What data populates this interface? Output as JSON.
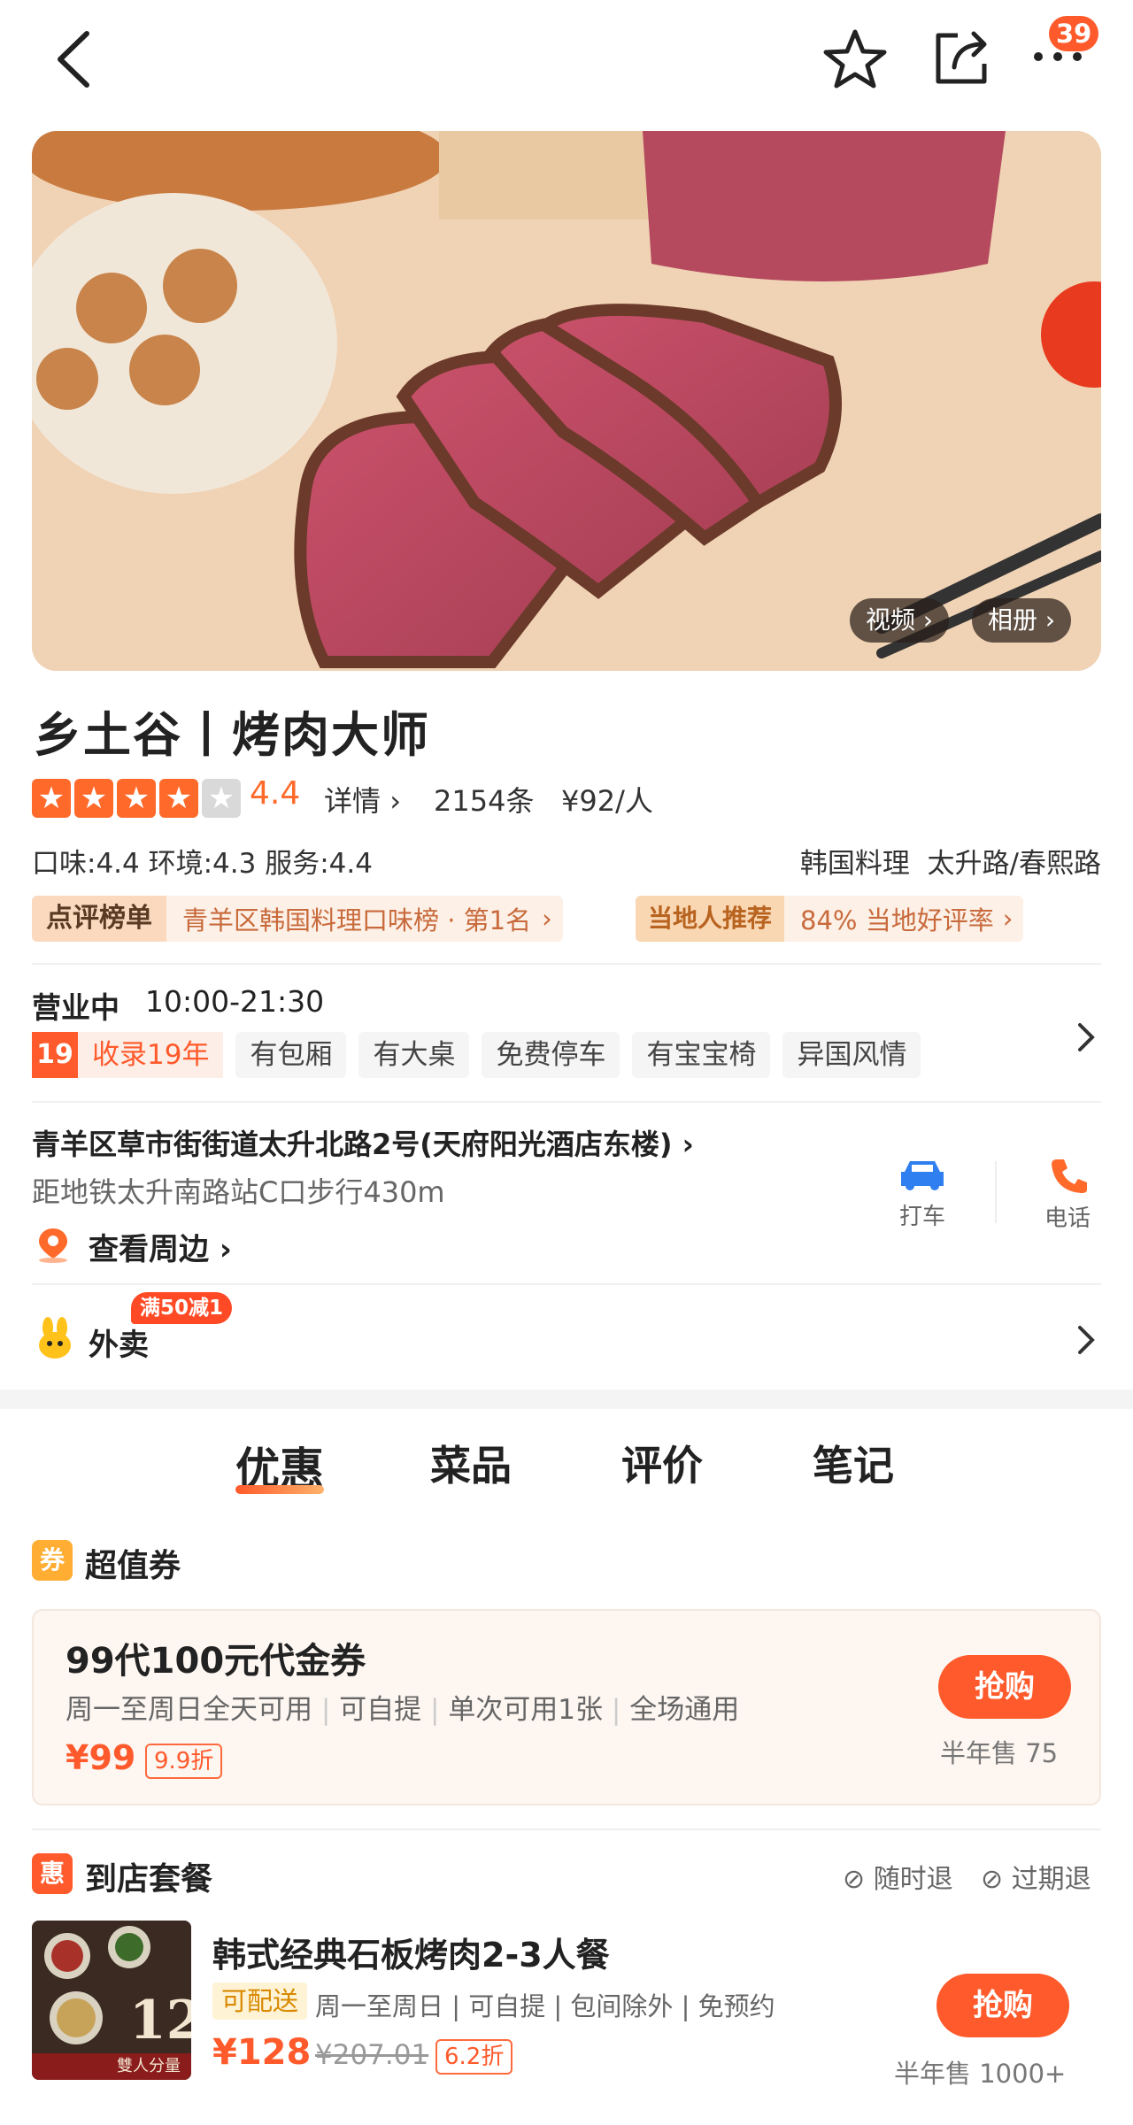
{
  "header": {
    "notification_count": "39"
  },
  "hero": {
    "video_label": "视频",
    "album_label": "相册"
  },
  "shop": {
    "name": "乡土谷丨烤肉大师",
    "rating": "4.4",
    "details_label": "详情",
    "review_count": "2154条",
    "avg_price": "¥92/人",
    "scores": "口味:4.4  环境:4.3  服务:4.4",
    "category": "韩国料理",
    "area": "太升路/春熙路"
  },
  "rank": {
    "badge1_label": "点评榜单",
    "badge1_text": "青羊区韩国料理口味榜 · 第1名",
    "badge2_label": "当地人推荐",
    "badge2_text": "84% 当地好评率"
  },
  "hours": {
    "status": "营业中",
    "time": "10:00-21:30",
    "years_icon": "19",
    "years_text": "收录19年",
    "tags": [
      "有包厢",
      "有大桌",
      "免费停车",
      "有宝宝椅",
      "异国风情"
    ]
  },
  "address": {
    "line1": "青羊区草市街街道太升北路2号(天府阳光酒店东楼)",
    "line2": "距地铁太升南路站C口步行430m",
    "nearby": "查看周边",
    "taxi_label": "打车",
    "phone_label": "电话"
  },
  "delivery": {
    "label": "外卖",
    "promo": "满50减1"
  },
  "tabs": [
    "优惠",
    "菜品",
    "评价",
    "笔记"
  ],
  "voucher_section": {
    "icon_label": "券",
    "title": "超值券",
    "name": "99代100元代金券",
    "conditions": [
      "周一至周日全天可用",
      "可自提",
      "单次可用1张",
      "全场通用"
    ],
    "price": "¥99",
    "discount": "9.9折",
    "buy_label": "抢购",
    "sold": "半年售 75"
  },
  "package_section": {
    "icon_label": "惠",
    "title": "到店套餐",
    "refund1": "随时退",
    "refund2": "过期退",
    "name": "韩式经典石板烤肉2-3人餐",
    "delivery_tag": "可配送",
    "conditions": "周一至周日 | 可自提 | 包间除外 | 免预约",
    "price": "¥128",
    "original_price": "¥207.01",
    "discount": "6.2折",
    "buy_label": "抢购",
    "sold": "半年售 1000+",
    "thumb_number": "12",
    "thumb_caption": "雙人分量"
  },
  "colors": {
    "accent": "#ff5a2b",
    "star": "#ff6a2b",
    "rank_bg": "#fdf0e6"
  }
}
